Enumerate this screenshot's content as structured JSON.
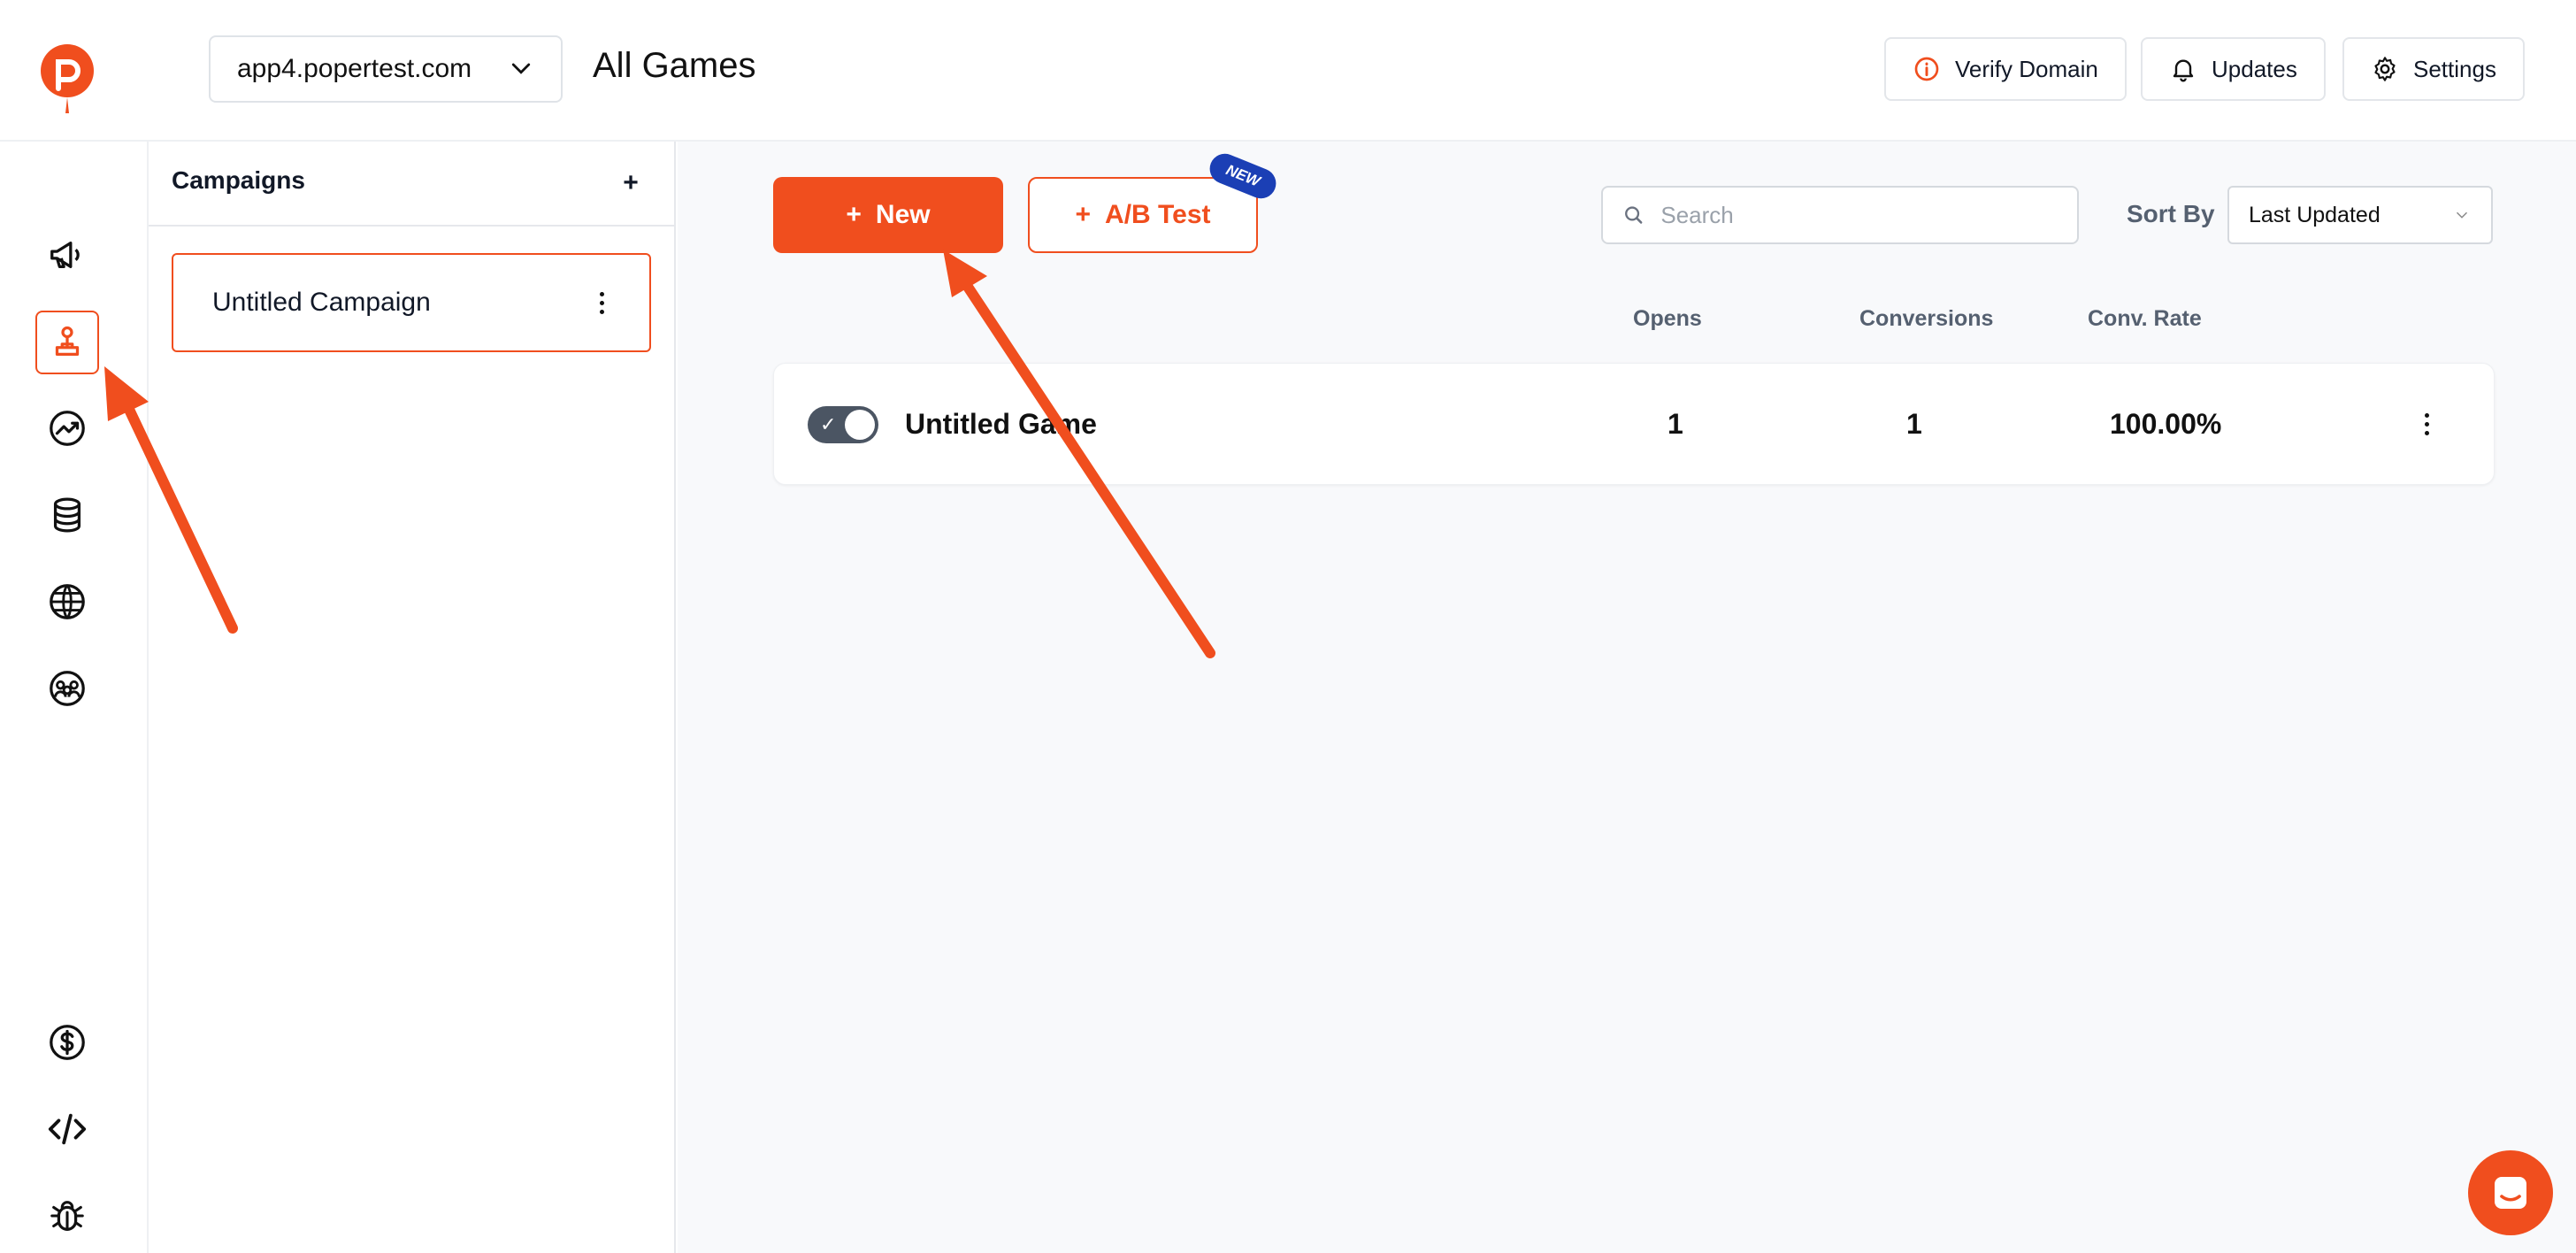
{
  "header": {
    "domain": "app4.popertest.com",
    "title": "All Games",
    "buttons": {
      "verify": "Verify Domain",
      "updates": "Updates",
      "settings": "Settings"
    }
  },
  "campaigns": {
    "title": "Campaigns",
    "add": "+",
    "items": [
      {
        "label": "Untitled Campaign"
      }
    ]
  },
  "toolbar": {
    "new_label": "New",
    "ab_label": "A/B Test",
    "plus": "+",
    "badge": "NEW",
    "search_placeholder": "Search",
    "sort_label": "Sort By",
    "sort_value": "Last Updated"
  },
  "table": {
    "columns": {
      "opens": "Opens",
      "conversions": "Conversions",
      "rate": "Conv. Rate"
    },
    "rows": [
      {
        "name": "Untitled Game",
        "enabled": true,
        "opens": "1",
        "conversions": "1",
        "rate": "100.00%"
      }
    ]
  },
  "colors": {
    "accent": "#f04e1e",
    "badge": "#1b3fb5",
    "muted": "#556070"
  },
  "icons": [
    "poper-logo",
    "megaphone-icon",
    "joystick-icon",
    "analytics-icon",
    "database-icon",
    "globe-icon",
    "audience-icon",
    "dollar-icon",
    "code-icon",
    "bug-icon",
    "chat-icon"
  ]
}
